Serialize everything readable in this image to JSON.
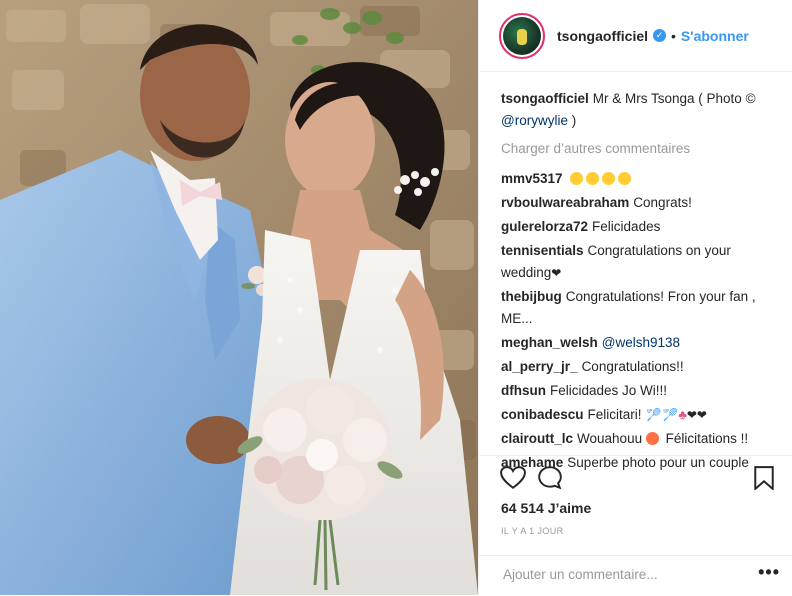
{
  "header": {
    "username": "tsongaofficiel",
    "verified_icon": "verified-badge-icon",
    "separator": "•",
    "follow_label": "S'abonner"
  },
  "caption": {
    "username": "tsongaofficiel",
    "text": "Mr & Mrs Tsonga ( Photo ©",
    "mention": "@rorywylie",
    "text_end": " )"
  },
  "load_more": "Charger d’autres commentaires",
  "comments": [
    {
      "user": "mmv5317",
      "text": ""
    },
    {
      "user": "rvboulwareabraham",
      "text": "Congrats!"
    },
    {
      "user": "gulerelorza72",
      "text": "Felicidades"
    },
    {
      "user": "tennisentials",
      "text": "Congratulations on your wedding"
    },
    {
      "user": "thebijbug",
      "text": "Congratulations! Fron your fan , ME..."
    },
    {
      "user": "meghan_welsh",
      "text": "",
      "mention": "@welsh9138"
    },
    {
      "user": "al_perry_jr_",
      "text": "Congratulations!!"
    },
    {
      "user": "dfhsun",
      "text": "Felicidades Jo Wi!!!"
    },
    {
      "user": "conibadescu",
      "text": "Felicitari!"
    },
    {
      "user": "clairoutt_lc",
      "text_a": "Wouahouu",
      "text_b": "Félicitations !!"
    },
    {
      "user": "amehame",
      "text": "Superbe photo pour un couple"
    }
  ],
  "actions": {
    "like_icon": "heart-outline-icon",
    "comment_icon": "comment-bubble-icon",
    "save_icon": "bookmark-icon",
    "likes": "64 514 J’aime",
    "time": "IL Y A 1 JOUR"
  },
  "add_comment": {
    "placeholder": "Ajouter un commentaire...",
    "options_label": "•••"
  },
  "colors": {
    "accent": "#3897f0",
    "text": "#262626",
    "muted": "#999999",
    "border": "#efefef"
  }
}
